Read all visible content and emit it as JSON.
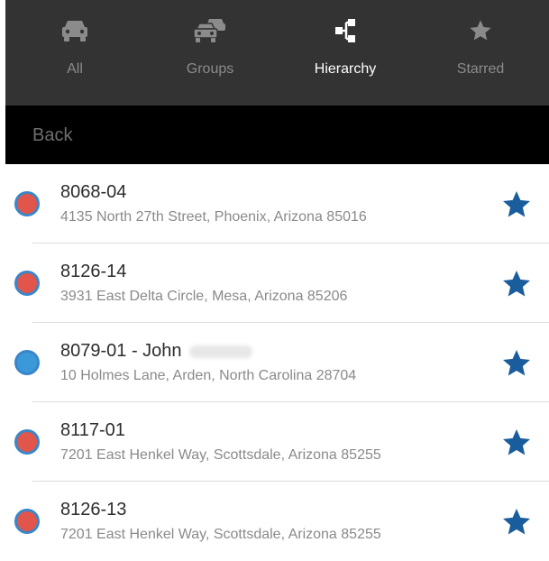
{
  "tabs": [
    {
      "label": "All",
      "icon": "car-icon",
      "active": false
    },
    {
      "label": "Groups",
      "icon": "cars-group-icon",
      "active": false
    },
    {
      "label": "Hierarchy",
      "icon": "hierarchy-icon",
      "active": true
    },
    {
      "label": "Starred",
      "icon": "star-icon",
      "active": false
    }
  ],
  "nav": {
    "back_label": "Back"
  },
  "list": {
    "items": [
      {
        "title": "8068-04",
        "address": "4135 North 27th Street, Phoenix, Arizona 85016",
        "status_color": "#e2554a",
        "starred": true
      },
      {
        "title": "8126-14",
        "address": "3931 East Delta Circle, Mesa, Arizona 85206",
        "status_color": "#e2554a",
        "starred": true
      },
      {
        "title": "8079-01 - John",
        "address": "10 Holmes Lane, Arden, North Carolina 28704",
        "status_color": "#3a9ad9",
        "starred": true
      },
      {
        "title": "8117-01",
        "address": "7201 East Henkel Way, Scottsdale, Arizona 85255",
        "status_color": "#e2554a",
        "starred": true
      },
      {
        "title": "8126-13",
        "address": "7201 East Henkel Way, Scottsdale, Arizona 85255",
        "status_color": "#e2554a",
        "starred": true
      }
    ]
  },
  "colors": {
    "star": "#1a5d9c",
    "tab_inactive": "#8b8b8b",
    "tab_active": "#ffffff"
  }
}
